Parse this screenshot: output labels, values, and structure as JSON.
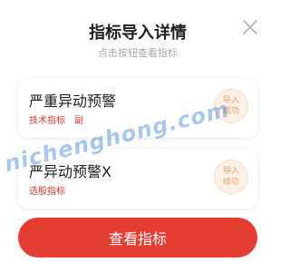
{
  "dialog": {
    "title": "指标导入详情",
    "subtitle": "点击按钮查看指标"
  },
  "close_button": {
    "icon": "close-icon"
  },
  "items": [
    {
      "name": "严重异动预警",
      "tags": [
        "技术指标",
        "副"
      ],
      "status": "导入成功"
    },
    {
      "name": "严异动预警X",
      "tags": [
        "选股指标"
      ],
      "status": "导入成功"
    }
  ],
  "primary_button": {
    "label": "查看指标"
  },
  "watermark": "nichenghong.com",
  "colors": {
    "accent": "#e63d33",
    "tag": "#e0392e",
    "badge_bg": "#fdf0e6",
    "badge_text": "#e4a060"
  }
}
